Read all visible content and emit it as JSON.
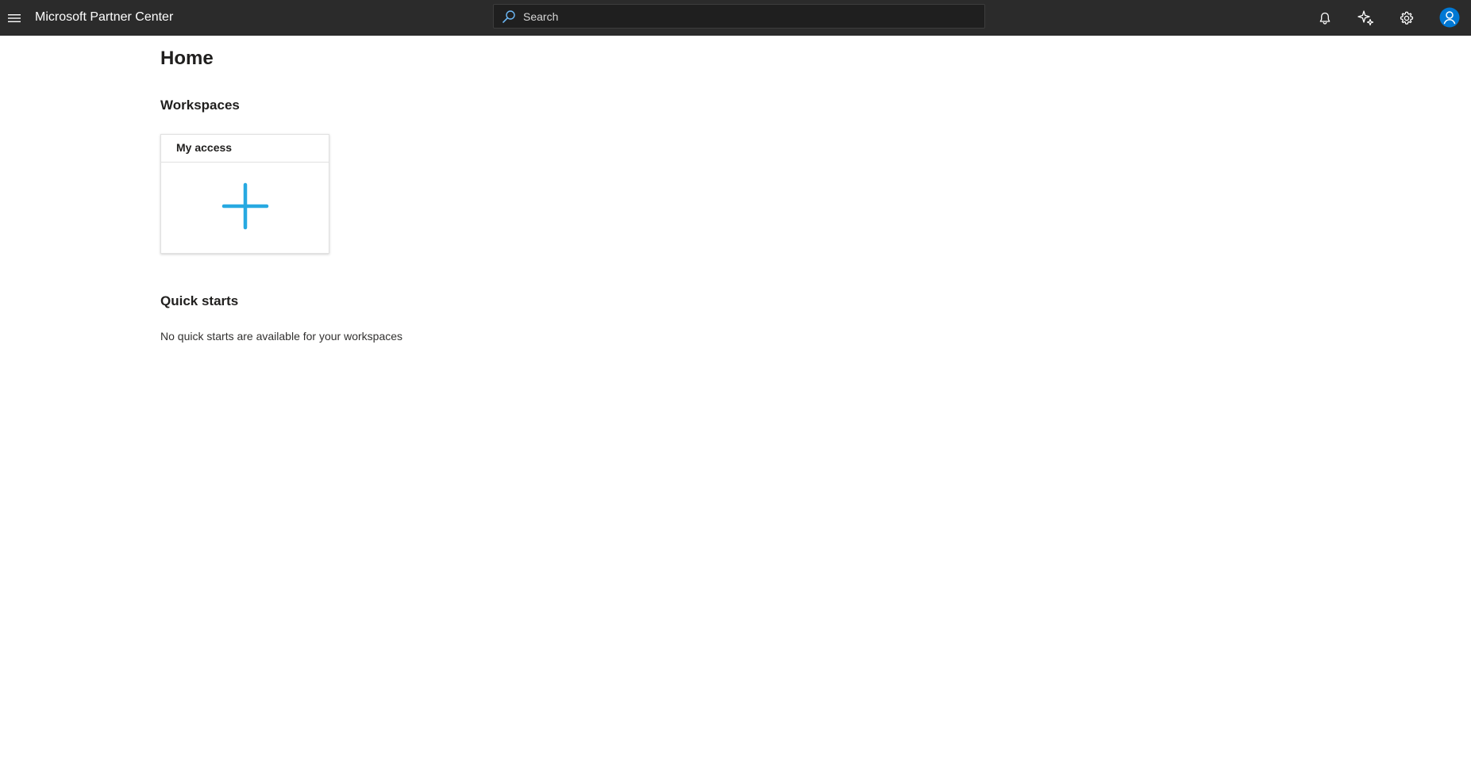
{
  "header": {
    "app_title": "Microsoft Partner Center",
    "search": {
      "placeholder": "Search",
      "value": ""
    },
    "icons": [
      "menu-icon",
      "bell-icon",
      "copilot-sparkle-icon",
      "gear-icon",
      "user-avatar-icon"
    ]
  },
  "main": {
    "page_title": "Home",
    "workspaces": {
      "title": "Workspaces",
      "tiles": [
        {
          "label": "My access",
          "icon": "add-plus-icon"
        }
      ]
    },
    "quick_starts": {
      "title": "Quick starts",
      "empty_message": "No quick starts are available for your workspaces"
    }
  },
  "colors": {
    "topbar_bg": "#2b2b2b",
    "search_bg": "#1f1f1f",
    "accent_plus": "#27a9e1",
    "avatar_blue": "#0078d4",
    "text_dark": "#201f1e"
  }
}
